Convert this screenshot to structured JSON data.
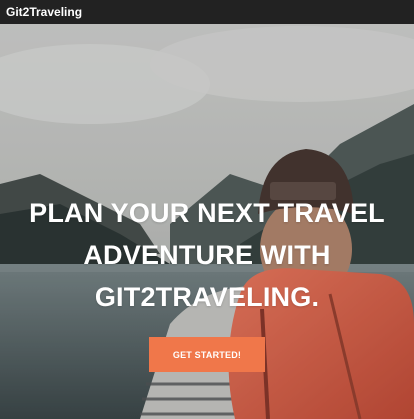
{
  "navbar": {
    "brand": "Git2Traveling"
  },
  "hero": {
    "headline_lines": [
      "PLAN YOUR NEXT TRAVEL",
      "ADVENTURE WITH",
      "GIT2TRAVELING."
    ],
    "cta_label": "GET STARTED!"
  },
  "colors": {
    "navbar_bg": "#222222",
    "cta_bg": "#f0774a",
    "text": "#ffffff"
  }
}
